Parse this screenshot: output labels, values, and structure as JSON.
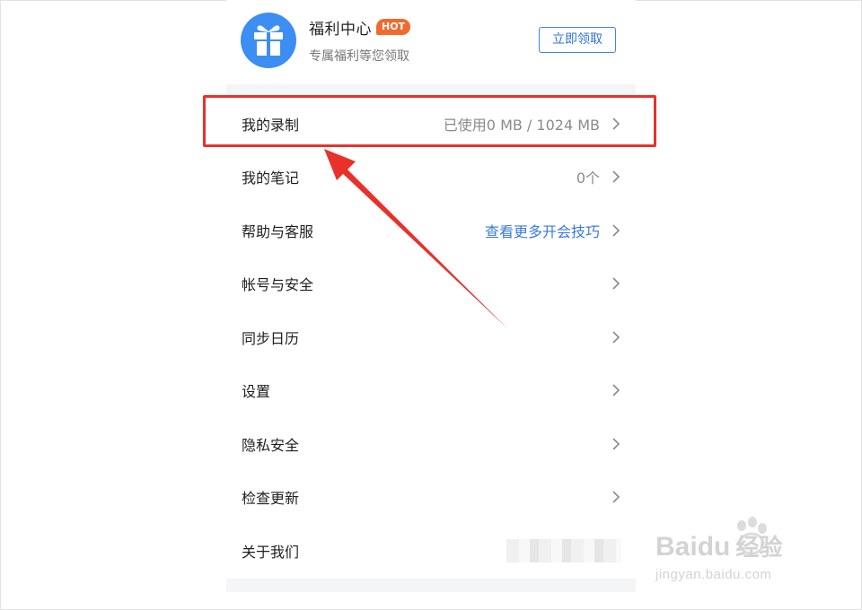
{
  "welfare": {
    "title": "福利中心",
    "badge": "HOT",
    "subtitle": "专属福利等您领取",
    "claim_label": "立即领取",
    "avatar_icon": "gift-icon",
    "avatar_color": "#3d8ef3"
  },
  "menu": {
    "items": [
      {
        "label": "我的录制",
        "value": "已使用0 MB / 1024 MB",
        "value_style": "muted",
        "chevron": true
      },
      {
        "label": "我的笔记",
        "value": "0个",
        "value_style": "muted",
        "chevron": true
      },
      {
        "label": "帮助与客服",
        "value": "查看更多开会技巧",
        "value_style": "link",
        "chevron": true
      },
      {
        "label": "帐号与安全",
        "value": "",
        "chevron": true
      },
      {
        "label": "同步日历",
        "value": "",
        "chevron": true
      },
      {
        "label": "设置",
        "value": "",
        "chevron": true
      },
      {
        "label": "隐私安全",
        "value": "",
        "chevron": true
      },
      {
        "label": "检查更新",
        "value": "",
        "chevron": true
      },
      {
        "label": "关于我们",
        "value": "",
        "value_blurred": true,
        "chevron": false
      }
    ]
  },
  "annotation": {
    "highlighted_item": "我的录制",
    "color": "#e8312b"
  },
  "watermark": {
    "brand": "Bai",
    "brand_tail": "du",
    "brand_cn": "经验",
    "domain": "jingyan.baidu.com"
  },
  "colors": {
    "accent_blue": "#3a7bdc",
    "hot_orange": "#f06a2e",
    "section_gap": "#f4f5f7"
  }
}
